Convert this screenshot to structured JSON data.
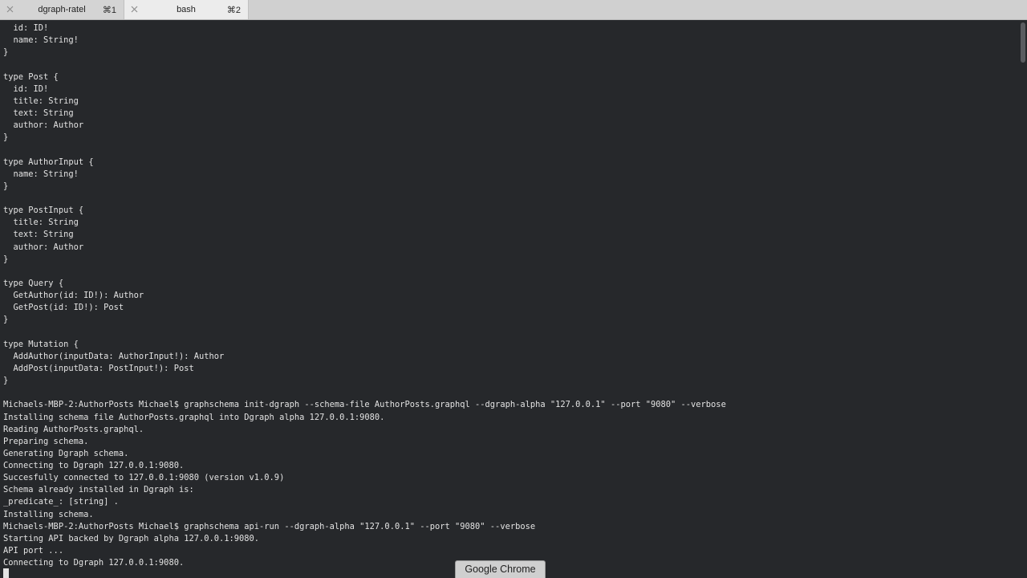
{
  "tabs": [
    {
      "title": "dgraph-ratel",
      "shortcut": "⌘1",
      "active": false
    },
    {
      "title": "bash",
      "shortcut": "⌘2",
      "active": true
    }
  ],
  "terminal": {
    "lines": [
      "  id: ID!",
      "  name: String!",
      "}",
      "",
      "type Post {",
      "  id: ID!",
      "  title: String",
      "  text: String",
      "  author: Author",
      "}",
      "",
      "type AuthorInput {",
      "  name: String!",
      "}",
      "",
      "type PostInput {",
      "  title: String",
      "  text: String",
      "  author: Author",
      "}",
      "",
      "type Query {",
      "  GetAuthor(id: ID!): Author",
      "  GetPost(id: ID!): Post",
      "}",
      "",
      "type Mutation {",
      "  AddAuthor(inputData: AuthorInput!): Author",
      "  AddPost(inputData: PostInput!): Post",
      "}",
      "",
      "Michaels-MBP-2:AuthorPosts Michael$ graphschema init-dgraph --schema-file AuthorPosts.graphql --dgraph-alpha \"127.0.0.1\" --port \"9080\" --verbose",
      "Installing schema file AuthorPosts.graphql into Dgraph alpha 127.0.0.1:9080.",
      "Reading AuthorPosts.graphql.",
      "Preparing schema.",
      "Generating Dgraph schema.",
      "Connecting to Dgraph 127.0.0.1:9080.",
      "Succesfully connected to 127.0.0.1:9080 (version v1.0.9)",
      "Schema already installed in Dgraph is:",
      "_predicate_: [string] .",
      "Installing schema.",
      "Michaels-MBP-2:AuthorPosts Michael$ graphschema api-run --dgraph-alpha \"127.0.0.1\" --port \"9080\" --verbose",
      "Starting API backed by Dgraph alpha 127.0.0.1:9080.",
      "API port ...",
      "Connecting to Dgraph 127.0.0.1:9080."
    ]
  },
  "tooltip": {
    "text": "Google Chrome"
  },
  "colors": {
    "terminal_bg": "#26282b",
    "terminal_fg": "#e3e3e3",
    "tabbar_bg": "#dcdcdc"
  },
  "icons": {
    "tab_close": "close-icon"
  }
}
